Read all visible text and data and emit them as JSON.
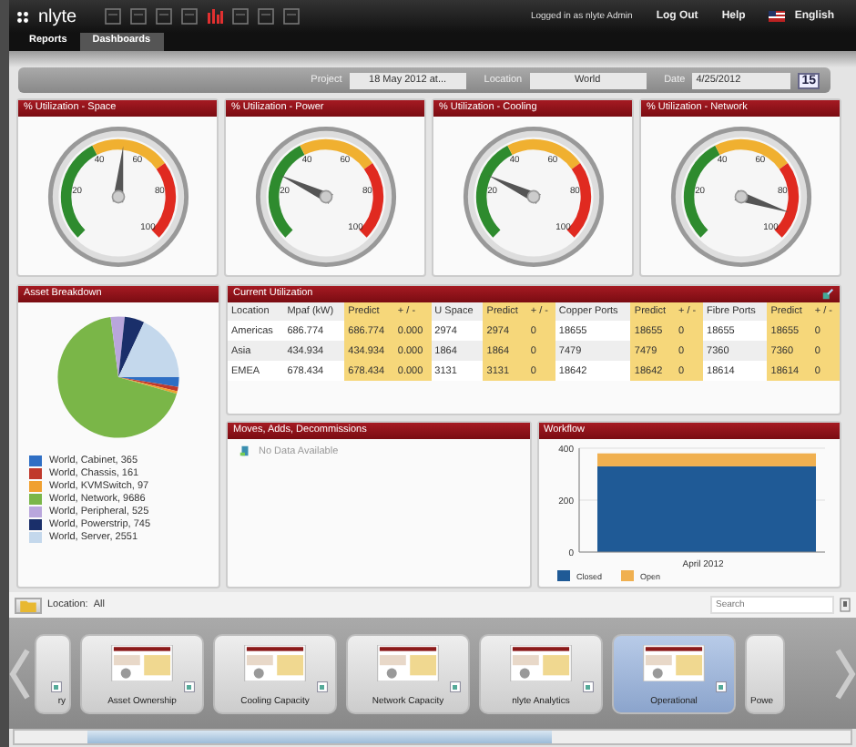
{
  "header": {
    "logo": "nlyte",
    "user": "Logged in as nlyte Admin",
    "links": [
      "Log Out",
      "Help"
    ],
    "language": "English"
  },
  "tabs": [
    {
      "label": "Reports",
      "selected": false
    },
    {
      "label": "Dashboards",
      "selected": true
    }
  ],
  "filters": [
    {
      "label": "Project",
      "value": "18 May 2012 at..."
    },
    {
      "label": "Location",
      "value": "World"
    },
    {
      "label": "Date",
      "value": "4/25/2012"
    }
  ],
  "calendar_day": "15",
  "gauges": [
    {
      "title": "% Utilization - Space",
      "scale": [
        "20",
        "40",
        "60",
        "80",
        "100"
      ]
    },
    {
      "title": "% Utilization - Power",
      "scale": [
        "20",
        "40",
        "60",
        "80",
        "100"
      ]
    },
    {
      "title": "% Utilization - Cooling",
      "scale": [
        "20",
        "40",
        "60",
        "80",
        "100"
      ]
    },
    {
      "title": "% Utilization - Network",
      "scale": [
        "20",
        "40",
        "60",
        "80",
        "100"
      ]
    }
  ],
  "asset_breakdown": {
    "title": "Asset Breakdown",
    "chart_data": {
      "type": "pie",
      "values": [
        2.58,
        1.14,
        0.69,
        68.55,
        3.72,
        5.27,
        18.05
      ]
    },
    "legend": [
      {
        "label": "World, Cabinet, 365",
        "color": "#2f6fc4"
      },
      {
        "label": "World, Chassis, 161",
        "color": "#c0392b"
      },
      {
        "label": "World, KVMSwitch, 97",
        "color": "#f0a030"
      },
      {
        "label": "World, Network, 9686",
        "color": "#7ab648"
      },
      {
        "label": "World, Peripheral, 525",
        "color": "#b9a6dc"
      },
      {
        "label": "World, Powerstrip, 745",
        "color": "#1a2f6a"
      },
      {
        "label": "World, Server, 2551",
        "color": "#c4d8ec"
      }
    ]
  },
  "utilization": {
    "title": "Current Utilization",
    "columns": [
      {
        "label": "Location",
        "predicted": false
      },
      {
        "label": "Mpaf (kW)",
        "predicted": false
      },
      {
        "label": "Predict",
        "predicted": true
      },
      {
        "label": "+ / -",
        "predicted": true
      },
      {
        "label": "U Space",
        "predicted": false
      },
      {
        "label": "Predict",
        "predicted": true
      },
      {
        "label": "+ / -",
        "predicted": true
      },
      {
        "label": "Copper Ports",
        "predicted": false
      },
      {
        "label": "Predict",
        "predicted": true
      },
      {
        "label": "+ / -",
        "predicted": true
      },
      {
        "label": "Fibre Ports",
        "predicted": false
      },
      {
        "label": "Predict",
        "predicted": true
      },
      {
        "label": "+ / -",
        "predicted": true
      }
    ],
    "rows": [
      [
        "Americas",
        "686.774",
        "686.774",
        "0.000",
        "2974",
        "2974",
        "0",
        "18655",
        "18655",
        "0",
        "18655",
        "18655",
        "0"
      ],
      [
        "Asia",
        "434.934",
        "434.934",
        "0.000",
        "1864",
        "1864",
        "0",
        "7479",
        "7479",
        "0",
        "7360",
        "7360",
        "0"
      ],
      [
        "EMEA",
        "678.434",
        "678.434",
        "0.000",
        "3131",
        "3131",
        "0",
        "18642",
        "18642",
        "0",
        "18614",
        "18614",
        "0"
      ]
    ]
  },
  "moves": {
    "title": "Moves, Adds, Decommissions",
    "message": "No Data Available"
  },
  "workflow": {
    "title": "Workflow",
    "chart_data": {
      "type": "bar",
      "stacked": true,
      "categories": [
        "April 2012"
      ],
      "ylim": [
        0,
        400
      ],
      "yticks": [
        0,
        200,
        400
      ],
      "series": [
        {
          "name": "Closed",
          "color": "#1f5a96",
          "values": [
            330
          ]
        },
        {
          "name": "Open",
          "color": "#f0b050",
          "values": [
            50
          ]
        }
      ]
    }
  },
  "location_bar": {
    "label": "Location:",
    "value": "All",
    "search_placeholder": "Search"
  },
  "dashboards": [
    {
      "label": "ry",
      "selected": false
    },
    {
      "label": "Asset Ownership",
      "selected": false
    },
    {
      "label": "Cooling Capacity",
      "selected": false
    },
    {
      "label": "Network Capacity",
      "selected": false
    },
    {
      "label": "nlyte Analytics",
      "selected": false
    },
    {
      "label": "Operational",
      "selected": true
    },
    {
      "label": "Powe",
      "selected": false
    }
  ]
}
